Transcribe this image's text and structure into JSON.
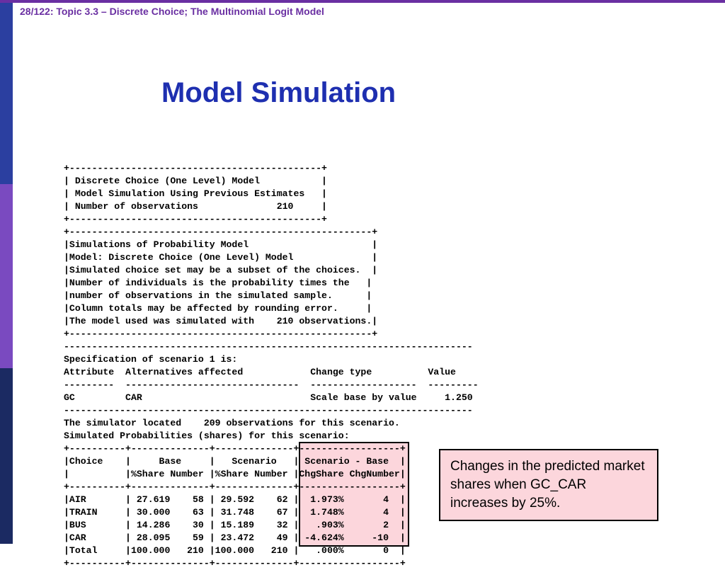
{
  "header": "28/122: Topic 3.3 – Discrete Choice; The Multinomial Logit Model",
  "title": "Model Simulation",
  "output": "+---------------------------------------------+\n| Discrete Choice (One Level) Model           |\n| Model Simulation Using Previous Estimates   |\n| Number of observations              210     |\n+---------------------------------------------+\n+------------------------------------------------------+\n|Simulations of Probability Model                      |\n|Model: Discrete Choice (One Level) Model              |\n|Simulated choice set may be a subset of the choices.  |\n|Number of individuals is the probability times the   |\n|number of observations in the simulated sample.      |\n|Column totals may be affected by rounding error.     |\n|The model used was simulated with    210 observations.|\n+------------------------------------------------------+\n-------------------------------------------------------------------------\nSpecification of scenario 1 is:\nAttribute  Alternatives affected            Change type          Value\n---------  -------------------------------  -------------------  ---------\nGC         CAR                              Scale base by value     1.250\n-------------------------------------------------------------------------\nThe simulator located    209 observations for this scenario.\nSimulated Probabilities (shares) for this scenario:\n+----------+--------------+--------------+------------------+\n|Choice    |     Base     |   Scenario   | Scenario - Base  |\n|          |%Share Number |%Share Number |ChgShare ChgNumber|\n+----------+--------------+--------------+------------------+\n|AIR       | 27.619    58 | 29.592    62 |  1.973%       4  |\n|TRAIN     | 30.000    63 | 31.748    67 |  1.748%       4  |\n|BUS       | 14.286    30 | 15.189    32 |   .903%       2  |\n|CAR       | 28.095    59 | 23.472    49 | -4.624%     -10  |\n|Total     |100.000   210 |100.000   210 |   .000%       0  |\n+----------+--------------+--------------+------------------+",
  "callout": "Changes in the predicted market shares when GC_CAR increases by 25%.",
  "chart_data": {
    "type": "table",
    "title": "Simulated Probabilities (shares) for this scenario",
    "scenario_spec": {
      "attribute": "GC",
      "alternatives_affected": "CAR",
      "change_type": "Scale base by value",
      "value": 1.25
    },
    "observations_model": 210,
    "observations_scenario": 209,
    "columns": [
      "Choice",
      "Base %Share",
      "Base Number",
      "Scenario %Share",
      "Scenario Number",
      "ChgShare",
      "ChgNumber"
    ],
    "rows": [
      [
        "AIR",
        27.619,
        58,
        29.592,
        62,
        1.973,
        4
      ],
      [
        "TRAIN",
        30.0,
        63,
        31.748,
        67,
        1.748,
        4
      ],
      [
        "BUS",
        14.286,
        30,
        15.189,
        32,
        0.903,
        2
      ],
      [
        "CAR",
        28.095,
        59,
        23.472,
        49,
        -4.624,
        -10
      ],
      [
        "Total",
        100.0,
        210,
        100.0,
        210,
        0.0,
        0
      ]
    ]
  }
}
